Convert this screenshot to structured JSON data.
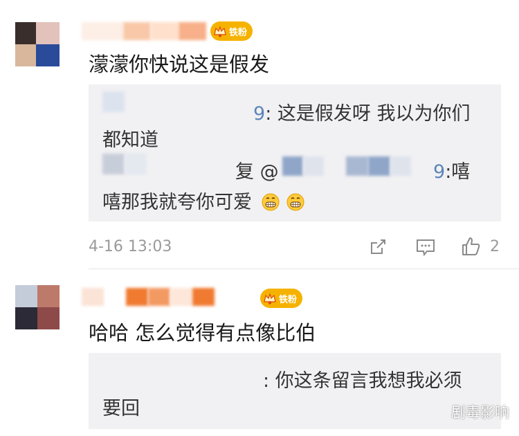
{
  "colors": {
    "accent_blue": "#5b86b8",
    "badge_gold": "#f6b200",
    "reply_bg": "#f1f1f3",
    "meta_gray": "#9a9a9a"
  },
  "comments": [
    {
      "badge": {
        "icon": "crown-icon",
        "label": "铁粉"
      },
      "text": "濛濛你快说这是假发",
      "replies": [
        {
          "lines": [
            {
              "mention": "9",
              "text": ": 这是假发呀  我以为你们"
            },
            {
              "text": "都知道"
            }
          ]
        },
        {
          "lines": [
            {
              "prefix": "复 @",
              "mention": "9",
              "text": ":嘻"
            },
            {
              "text": "嘻那我就夸你可爱"
            }
          ],
          "emoji": [
            "grin-emoji",
            "grin-emoji"
          ]
        }
      ],
      "timestamp": "4-16 13:03",
      "actions": {
        "share_icon": "share-icon",
        "comment_icon": "comment-icon",
        "like_icon": "thumbs-up-icon",
        "like_count": "2"
      }
    },
    {
      "badge": {
        "icon": "crown-icon",
        "label": "铁粉"
      },
      "text": "哈哈  怎么觉得有点像比伯",
      "replies": [
        {
          "lines": [
            {
              "text": ": 你这条留言我想我必须"
            },
            {
              "text": "要回"
            }
          ]
        }
      ]
    }
  ],
  "watermark": "剧毒影响"
}
